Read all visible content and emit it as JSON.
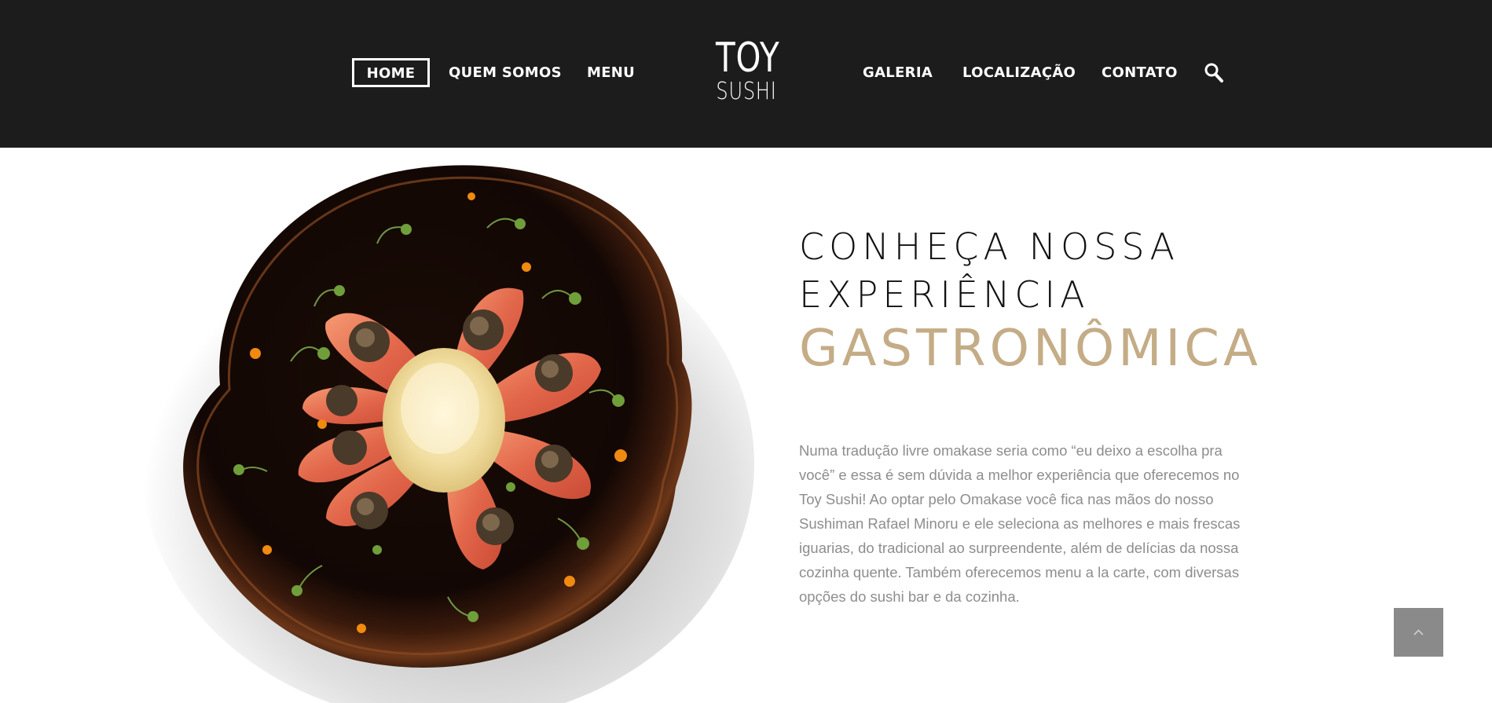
{
  "nav": {
    "home": "HOME",
    "quem_somos": "QUEM SOMOS",
    "menu": "MENU",
    "galeria": "GALERIA",
    "localizacao": "LOCALIZAÇÃO",
    "contato": "CONTATO",
    "search_icon": "search-icon"
  },
  "logo": {
    "top": "TOY",
    "bottom": "SUSHI"
  },
  "hero": {
    "line1": "CONHEÇA NOSSA",
    "line2": "EXPERIÊNCIA",
    "accent": "GASTRONÔMICA",
    "description": "Numa tradução livre omakase seria como “eu deixo a escolha pra você” e essa é sem dúvida a melhor experiência que oferecemos no Toy Sushi! Ao optar pelo Omakase você fica nas mãos do nosso Sushiman Rafael Minoru e ele seleciona as melhores e mais frescas iguarias, do tradicional ao surpreendente, além de delícias da nossa cozinha quente. Também oferecemos menu a la carte, com diversas opções do sushi bar e da cozinha."
  },
  "colors": {
    "header_bg": "#1c1c1c",
    "accent": "#c4ac87",
    "body_text": "#8d8d8d",
    "scroll_button": "#8a8a8a"
  },
  "icons": {
    "scroll_top": "chevron-up-icon"
  }
}
